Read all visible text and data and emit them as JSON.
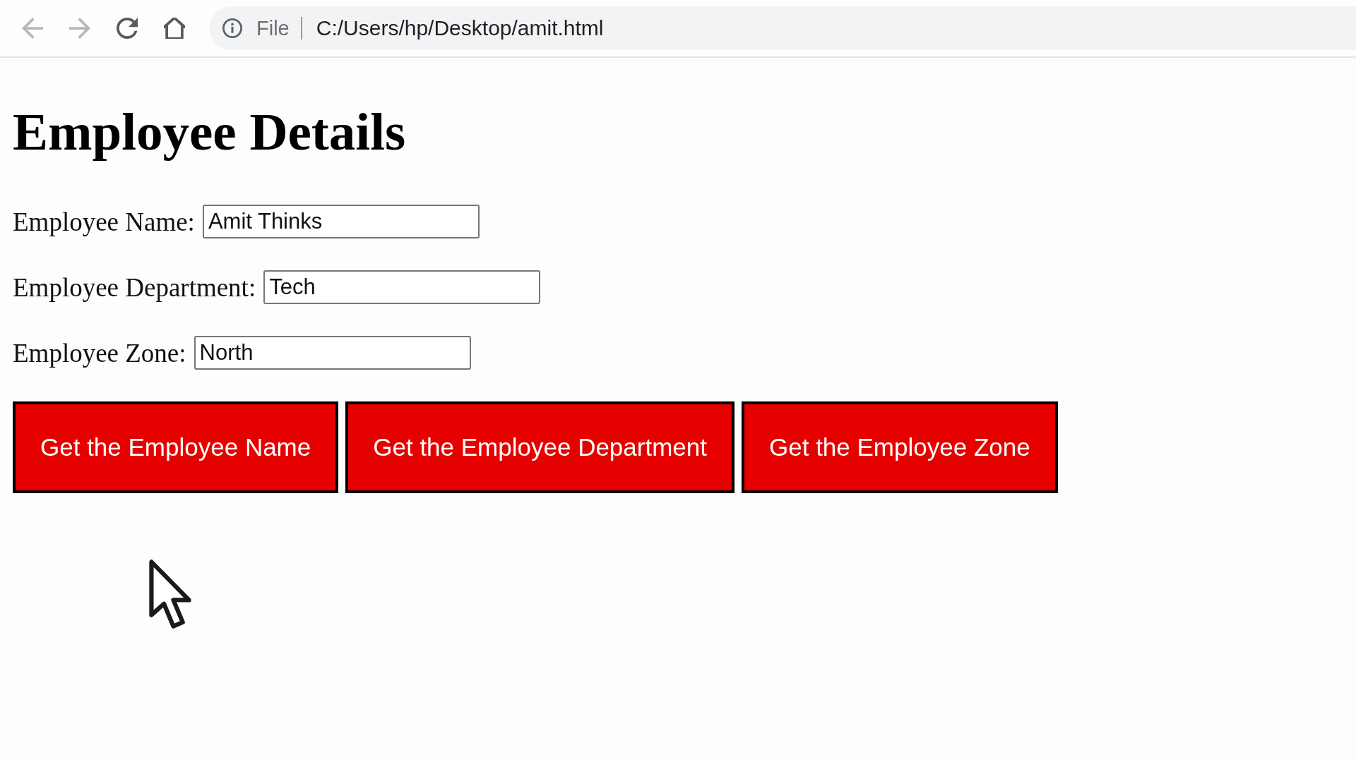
{
  "browser_toolbar": {
    "navigation": [
      {
        "kind": "back",
        "disabled": true
      },
      {
        "kind": "forward",
        "disabled": true
      },
      {
        "kind": "reload",
        "disabled": false
      },
      {
        "kind": "home",
        "disabled": false
      }
    ],
    "address_bar": {
      "scheme_label": "File",
      "url": "C:/Users/hp/Desktop/amit.html"
    }
  },
  "page": {
    "heading": "Employee Details",
    "fields": [
      {
        "label": "Employee Name:",
        "value": "Amit Thinks"
      },
      {
        "label": "Employee Department:",
        "value": "Tech"
      },
      {
        "label": "Employee Zone:",
        "value": "North"
      }
    ],
    "buttons": [
      "Get the Employee Name",
      "Get the Employee Department",
      "Get the Employee Zone"
    ]
  }
}
